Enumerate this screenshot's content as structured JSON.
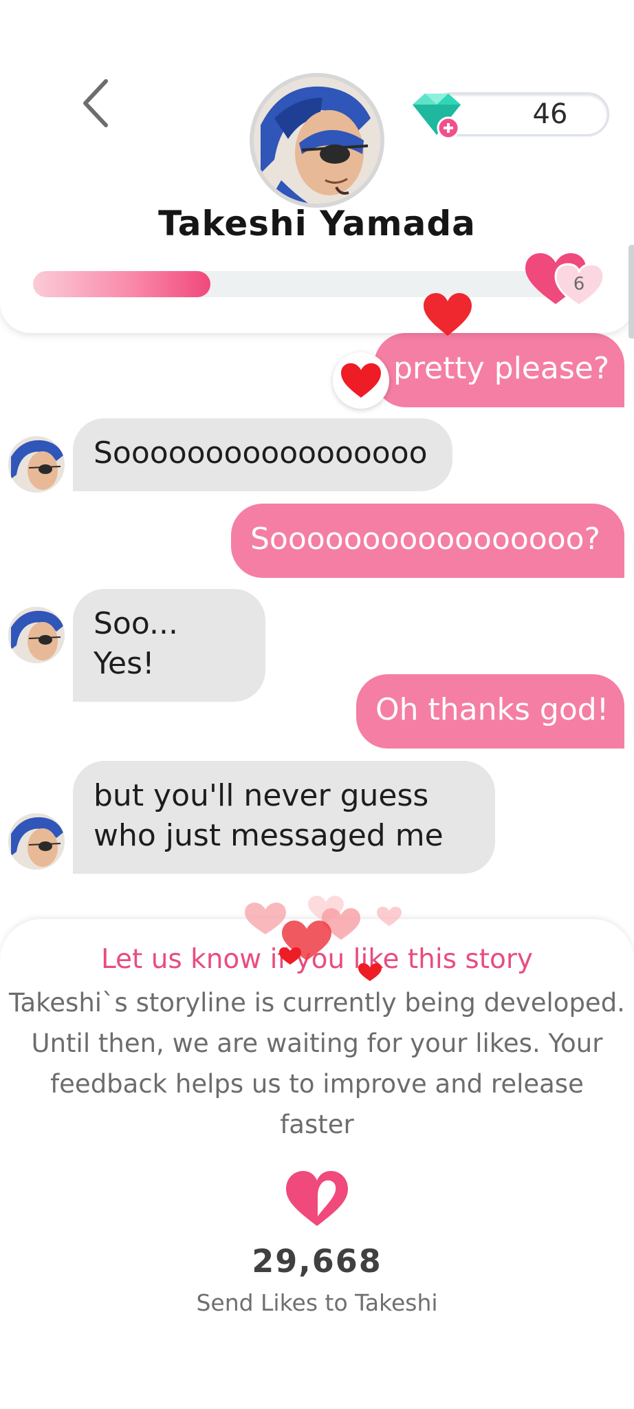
{
  "header": {
    "character_name": "Takeshi Yamada",
    "gems": "46",
    "level": "6",
    "relationship_progress": 0.34
  },
  "chat": {
    "messages": [
      {
        "from": "user",
        "text": "pretty please?"
      },
      {
        "from": "character",
        "text": "Sooooooooooooooooo"
      },
      {
        "from": "user",
        "text": "Sooooooooooooooooo?"
      },
      {
        "from": "character",
        "text": "Soo... Yes!"
      },
      {
        "from": "user",
        "text": "Oh thanks god!"
      },
      {
        "from": "character",
        "lines": [
          "but you'll never guess",
          "who just messaged me"
        ]
      }
    ]
  },
  "sheet": {
    "title": "Let us know if you like this story",
    "body_lines": [
      "Takeshi`s storyline is currently being developed.",
      "Until then, we are waiting for your likes. Your",
      "feedback helps us to improve and release",
      "faster"
    ],
    "likes_count": "29,668",
    "likes_cta": "Send Likes to Takeshi"
  },
  "colors": {
    "accent_pink": "#f57ea4",
    "title_pink": "#e84d7d",
    "heart_red": "#ee1c25",
    "bubble_gray": "#e6e6e6"
  }
}
